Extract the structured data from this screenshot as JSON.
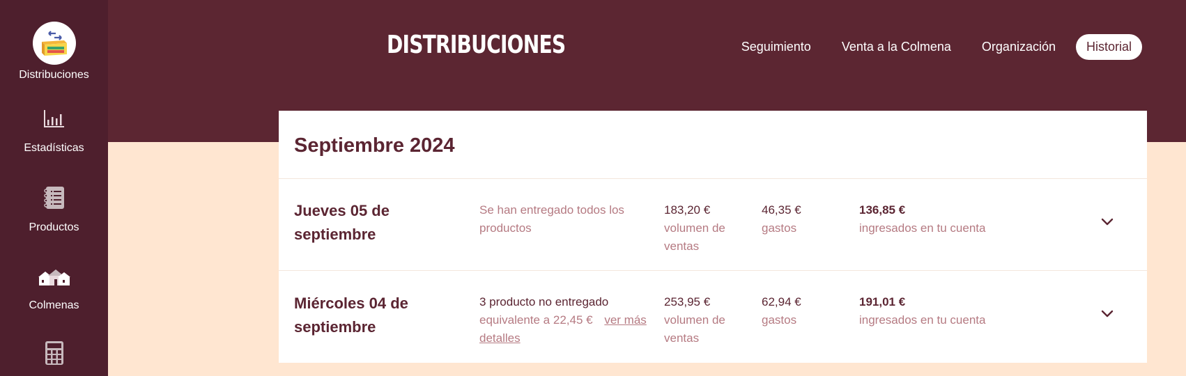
{
  "sidebar": {
    "items": [
      {
        "label": "Distribuciones",
        "icon": "distribution-box-icon"
      },
      {
        "label": "Estadísticas",
        "icon": "bar-chart-icon"
      },
      {
        "label": "Productos",
        "icon": "notebook-list-icon"
      },
      {
        "label": "Colmenas",
        "icon": "houses-icon"
      },
      {
        "label": "",
        "icon": "calculator-icon"
      }
    ]
  },
  "header": {
    "title": "DISTRIBUCIONES",
    "nav": [
      {
        "label": "Seguimiento"
      },
      {
        "label": "Venta a la Colmena"
      },
      {
        "label": "Organización"
      },
      {
        "label": "Historial",
        "active": true
      }
    ]
  },
  "main": {
    "month": "Septiembre 2024",
    "rows": [
      {
        "date_line1": "Jueves 05 de",
        "date_line2": "septiembre",
        "status_text": "Se han entregado todos los productos",
        "sales_value": "183,20 €",
        "sales_label": "volumen de ventas",
        "costs_value": "46,35 €",
        "costs_label": "gastos",
        "income_value": "136,85 €",
        "income_label": "ingresados en tu cuenta"
      },
      {
        "date_line1": "Miércoles 04 de",
        "date_line2": "septiembre",
        "status_main": "3 producto no entregado",
        "status_sub": "equivalente a 22,45 €",
        "status_link": "ver más detalles",
        "sales_value": "253,95 €",
        "sales_label": "volumen de ventas",
        "costs_value": "62,94 €",
        "costs_label": "gastos",
        "income_value": "191,01 €",
        "income_label": "ingresados en tu cuenta"
      }
    ]
  },
  "colors": {
    "sidebar_bg": "#4e1f2d",
    "header_bg": "#5c2632",
    "page_bg": "#ffe6d1",
    "accent_text": "#5b2532",
    "muted_text": "#b57a82"
  }
}
